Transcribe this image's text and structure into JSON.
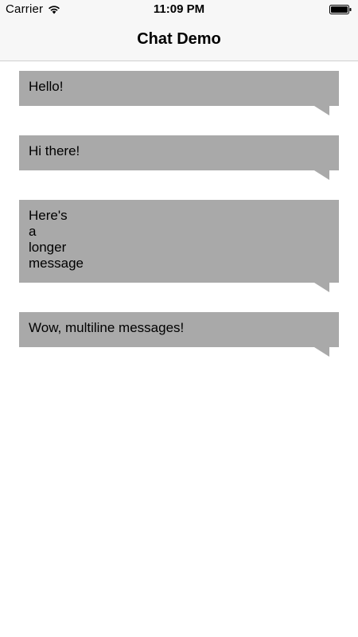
{
  "status_bar": {
    "carrier": "Carrier",
    "time": "11:09 PM",
    "wifi_icon": "wifi-icon",
    "battery_icon": "battery-icon"
  },
  "nav": {
    "title": "Chat Demo"
  },
  "messages": [
    {
      "text": "Hello!"
    },
    {
      "text": "Hi there!"
    },
    {
      "text": "Here's\na\nlonger\nmessage"
    },
    {
      "text": "Wow, multiline messages!"
    }
  ],
  "colors": {
    "bubble": "#a9a9a9",
    "bar_background": "#f7f7f7"
  }
}
